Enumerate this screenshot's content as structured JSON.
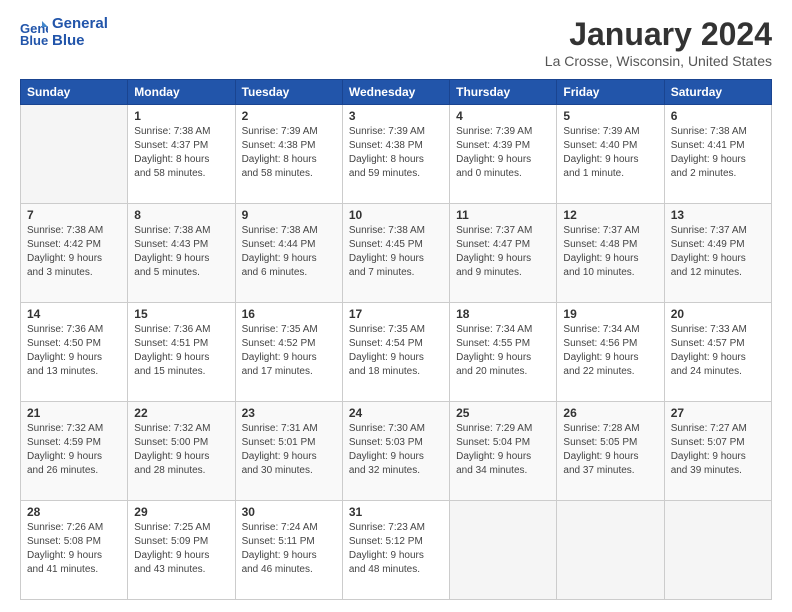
{
  "logo": {
    "line1": "General",
    "line2": "Blue"
  },
  "title": "January 2024",
  "location": "La Crosse, Wisconsin, United States",
  "weekdays": [
    "Sunday",
    "Monday",
    "Tuesday",
    "Wednesday",
    "Thursday",
    "Friday",
    "Saturday"
  ],
  "weeks": [
    [
      {
        "day": "",
        "info": ""
      },
      {
        "day": "1",
        "info": "Sunrise: 7:38 AM\nSunset: 4:37 PM\nDaylight: 8 hours\nand 58 minutes."
      },
      {
        "day": "2",
        "info": "Sunrise: 7:39 AM\nSunset: 4:38 PM\nDaylight: 8 hours\nand 58 minutes."
      },
      {
        "day": "3",
        "info": "Sunrise: 7:39 AM\nSunset: 4:38 PM\nDaylight: 8 hours\nand 59 minutes."
      },
      {
        "day": "4",
        "info": "Sunrise: 7:39 AM\nSunset: 4:39 PM\nDaylight: 9 hours\nand 0 minutes."
      },
      {
        "day": "5",
        "info": "Sunrise: 7:39 AM\nSunset: 4:40 PM\nDaylight: 9 hours\nand 1 minute."
      },
      {
        "day": "6",
        "info": "Sunrise: 7:38 AM\nSunset: 4:41 PM\nDaylight: 9 hours\nand 2 minutes."
      }
    ],
    [
      {
        "day": "7",
        "info": "Sunrise: 7:38 AM\nSunset: 4:42 PM\nDaylight: 9 hours\nand 3 minutes."
      },
      {
        "day": "8",
        "info": "Sunrise: 7:38 AM\nSunset: 4:43 PM\nDaylight: 9 hours\nand 5 minutes."
      },
      {
        "day": "9",
        "info": "Sunrise: 7:38 AM\nSunset: 4:44 PM\nDaylight: 9 hours\nand 6 minutes."
      },
      {
        "day": "10",
        "info": "Sunrise: 7:38 AM\nSunset: 4:45 PM\nDaylight: 9 hours\nand 7 minutes."
      },
      {
        "day": "11",
        "info": "Sunrise: 7:37 AM\nSunset: 4:47 PM\nDaylight: 9 hours\nand 9 minutes."
      },
      {
        "day": "12",
        "info": "Sunrise: 7:37 AM\nSunset: 4:48 PM\nDaylight: 9 hours\nand 10 minutes."
      },
      {
        "day": "13",
        "info": "Sunrise: 7:37 AM\nSunset: 4:49 PM\nDaylight: 9 hours\nand 12 minutes."
      }
    ],
    [
      {
        "day": "14",
        "info": "Sunrise: 7:36 AM\nSunset: 4:50 PM\nDaylight: 9 hours\nand 13 minutes."
      },
      {
        "day": "15",
        "info": "Sunrise: 7:36 AM\nSunset: 4:51 PM\nDaylight: 9 hours\nand 15 minutes."
      },
      {
        "day": "16",
        "info": "Sunrise: 7:35 AM\nSunset: 4:52 PM\nDaylight: 9 hours\nand 17 minutes."
      },
      {
        "day": "17",
        "info": "Sunrise: 7:35 AM\nSunset: 4:54 PM\nDaylight: 9 hours\nand 18 minutes."
      },
      {
        "day": "18",
        "info": "Sunrise: 7:34 AM\nSunset: 4:55 PM\nDaylight: 9 hours\nand 20 minutes."
      },
      {
        "day": "19",
        "info": "Sunrise: 7:34 AM\nSunset: 4:56 PM\nDaylight: 9 hours\nand 22 minutes."
      },
      {
        "day": "20",
        "info": "Sunrise: 7:33 AM\nSunset: 4:57 PM\nDaylight: 9 hours\nand 24 minutes."
      }
    ],
    [
      {
        "day": "21",
        "info": "Sunrise: 7:32 AM\nSunset: 4:59 PM\nDaylight: 9 hours\nand 26 minutes."
      },
      {
        "day": "22",
        "info": "Sunrise: 7:32 AM\nSunset: 5:00 PM\nDaylight: 9 hours\nand 28 minutes."
      },
      {
        "day": "23",
        "info": "Sunrise: 7:31 AM\nSunset: 5:01 PM\nDaylight: 9 hours\nand 30 minutes."
      },
      {
        "day": "24",
        "info": "Sunrise: 7:30 AM\nSunset: 5:03 PM\nDaylight: 9 hours\nand 32 minutes."
      },
      {
        "day": "25",
        "info": "Sunrise: 7:29 AM\nSunset: 5:04 PM\nDaylight: 9 hours\nand 34 minutes."
      },
      {
        "day": "26",
        "info": "Sunrise: 7:28 AM\nSunset: 5:05 PM\nDaylight: 9 hours\nand 37 minutes."
      },
      {
        "day": "27",
        "info": "Sunrise: 7:27 AM\nSunset: 5:07 PM\nDaylight: 9 hours\nand 39 minutes."
      }
    ],
    [
      {
        "day": "28",
        "info": "Sunrise: 7:26 AM\nSunset: 5:08 PM\nDaylight: 9 hours\nand 41 minutes."
      },
      {
        "day": "29",
        "info": "Sunrise: 7:25 AM\nSunset: 5:09 PM\nDaylight: 9 hours\nand 43 minutes."
      },
      {
        "day": "30",
        "info": "Sunrise: 7:24 AM\nSunset: 5:11 PM\nDaylight: 9 hours\nand 46 minutes."
      },
      {
        "day": "31",
        "info": "Sunrise: 7:23 AM\nSunset: 5:12 PM\nDaylight: 9 hours\nand 48 minutes."
      },
      {
        "day": "",
        "info": ""
      },
      {
        "day": "",
        "info": ""
      },
      {
        "day": "",
        "info": ""
      }
    ]
  ]
}
